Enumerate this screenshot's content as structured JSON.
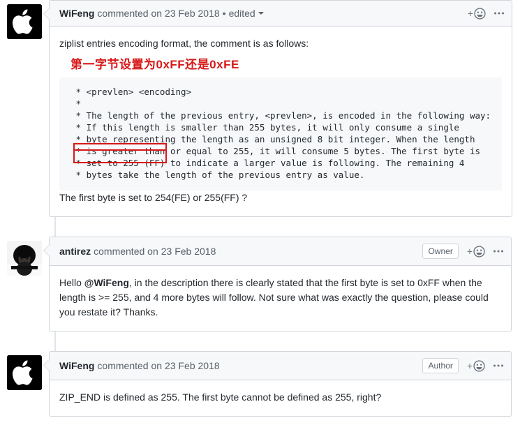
{
  "thread": {
    "comments": [
      {
        "id": "comment-wifeng-1",
        "author": "WiFeng",
        "action": "commented on",
        "date": "23 Feb 2018",
        "separator": "•",
        "edited_label": "edited",
        "badge": null,
        "avatar": "apple-logo-avatar",
        "reaction_plus": "+",
        "reaction_icon": "smiley-icon",
        "menu_icon": "kebab-menu-icon",
        "body": {
          "intro": "ziplist entries encoding format, the comment is as follows:",
          "annotation_cn": "第一字节设置为0xFF还是0xFE",
          "code": " * <prevlen> <encoding>\n *\n * The length of the previous entry, <prevlen>, is encoded in the following way:\n * If this length is smaller than 255 bytes, it will only consume a single\n * byte representing the length as an unsigned 8 bit integer. When the length\n * is greater than or equal to 255, it will consume 5 bytes. The first byte is\n * set to 255 (FF) to indicate a larger value is following. The remaining 4\n * bytes take the length of the previous entry as value.",
          "question": "The first byte is set to 254(FE) or 255(FF) ?"
        }
      },
      {
        "id": "comment-antirez",
        "author": "antirez",
        "action": "commented on",
        "date": "23 Feb 2018",
        "separator": "",
        "edited_label": "",
        "badge": "Owner",
        "avatar": "photo-avatar",
        "reaction_plus": "+",
        "reaction_icon": "smiley-icon",
        "menu_icon": "kebab-menu-icon",
        "body": {
          "text_before_mention": "Hello ",
          "mention": "@WiFeng",
          "text_after_mention": ", in the description there is clearly stated that the first byte is set to 0xFF when the length is >= 255, and 4 more bytes will follow. Not sure what was exactly the question, please could you restate it? Thanks."
        }
      },
      {
        "id": "comment-wifeng-2",
        "author": "WiFeng",
        "action": "commented on",
        "date": "23 Feb 2018",
        "separator": "",
        "edited_label": "",
        "badge": "Author",
        "avatar": "apple-logo-avatar",
        "reaction_plus": "+",
        "reaction_icon": "smiley-icon",
        "menu_icon": "kebab-menu-icon",
        "body": {
          "text": "ZIP_END is defined as 255. The first byte cannot be defined as 255, right?"
        }
      }
    ]
  },
  "colors": {
    "annotation_red": "#d81717",
    "header_bg": "#f6f8fa",
    "border": "#d1d5da",
    "code_bg": "#f6f8fa",
    "text": "#24292e",
    "muted_text": "#586069"
  }
}
